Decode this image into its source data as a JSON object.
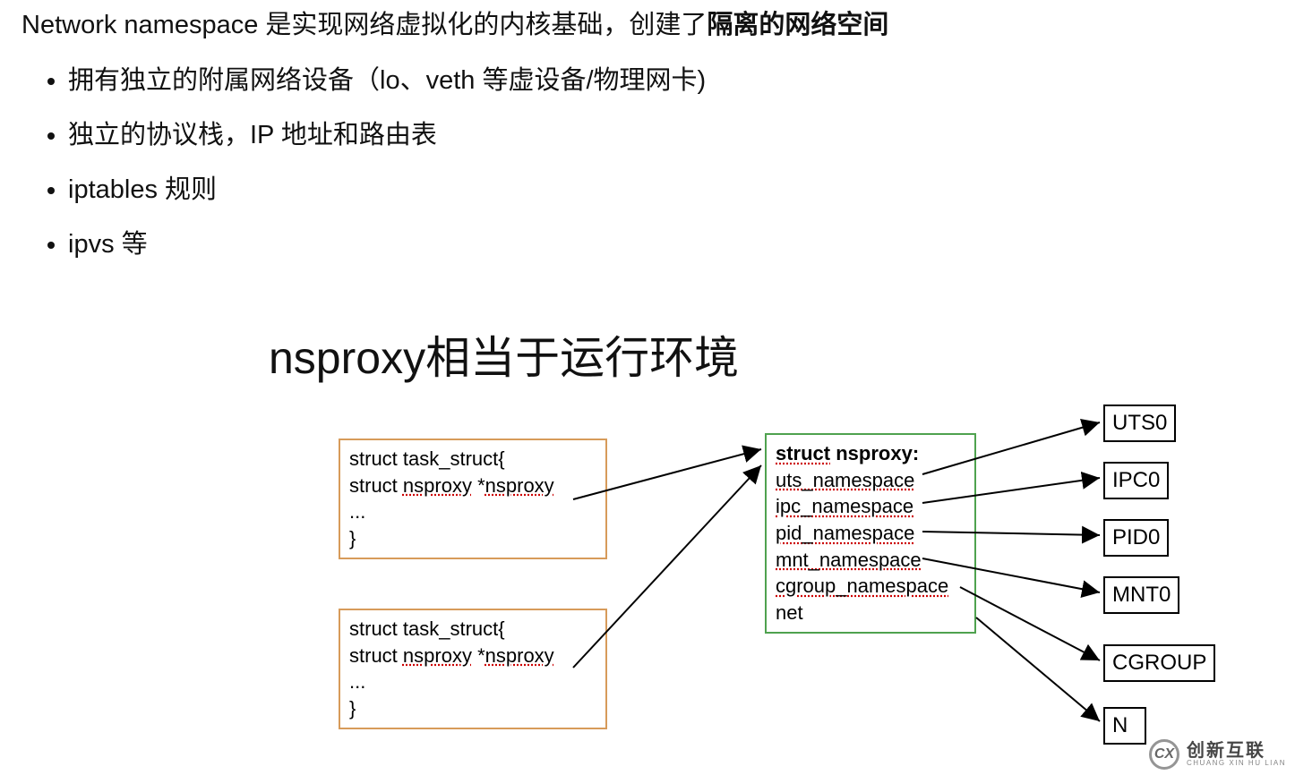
{
  "intro": {
    "lead": "Network namespace 是实现网络虚拟化的内核基础，创建了",
    "bold": "隔离的网络空间"
  },
  "bullets": [
    "拥有独立的附属网络设备（lo、veth 等虚设备/物理网卡)",
    "独立的协议栈，IP 地址和路由表",
    "iptables 规则",
    "ipvs 等"
  ],
  "subtitle": "nsproxy相当于运行环境",
  "task_struct": {
    "line1": "struct task_struct{",
    "line2_a": " struct ",
    "line2_u1": "nsproxy",
    "line2_b": " *",
    "line2_u2": "nsproxy",
    "line3": " ...",
    "line4": "}"
  },
  "nsproxy": {
    "title_u": "struct",
    "title_rest": " nsproxy:",
    "fields": [
      "uts_namespace",
      "ipc_namespace",
      "pid_namespace",
      "mnt_namespace",
      "cgroup_namespace",
      "net"
    ]
  },
  "ns_targets": [
    "UTS0",
    "IPC0",
    "PID0",
    "MNT0",
    "CGROUP",
    "N"
  ],
  "watermark": {
    "logo": "CX",
    "cn": "创新互联",
    "py": "CHUANG XIN HU LIAN"
  }
}
